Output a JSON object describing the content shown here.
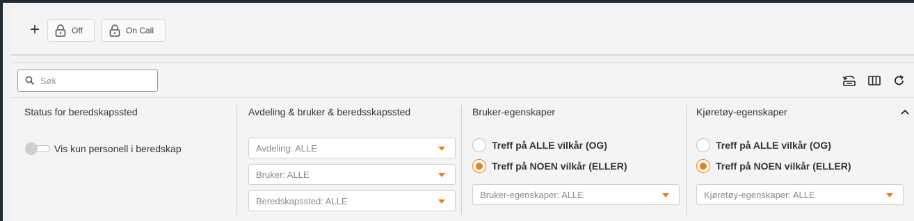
{
  "toolbar": {
    "add_label": "+",
    "buttons": [
      {
        "label": "Off",
        "icon": "lock-icon"
      },
      {
        "label": "On Call",
        "icon": "lock-icon"
      }
    ]
  },
  "search": {
    "placeholder": "Søk",
    "value": ""
  },
  "actions": {
    "icons": [
      "filter-reset-icon",
      "columns-icon",
      "refresh-icon"
    ]
  },
  "accent_color": "#f07d14",
  "columns": [
    {
      "title": "Status for beredskapssted",
      "toggle": {
        "label": "Vis kun personell i beredskap",
        "on": false
      }
    },
    {
      "title": "Avdeling & bruker & beredsskapssted",
      "selects": [
        "Avdeling: ALLE",
        "Bruker: ALLE",
        "Beredskapssted: ALLE"
      ]
    },
    {
      "title": "Bruker-egenskaper",
      "radios": [
        {
          "label": "Treff på ALLE vilkår (OG)",
          "checked": false
        },
        {
          "label": "Treff på NOEN vilkår (ELLER)",
          "checked": true
        }
      ],
      "select": "Bruker-egenskaper: ALLE"
    },
    {
      "title": "Kjøretøy-egenskaper",
      "radios": [
        {
          "label": "Treff på ALLE vilkår (OG)",
          "checked": false
        },
        {
          "label": "Treff på NOEN vilkår (ELLER)",
          "checked": true
        }
      ],
      "select": "Kjøretøy-egenskaper: ALLE"
    }
  ]
}
